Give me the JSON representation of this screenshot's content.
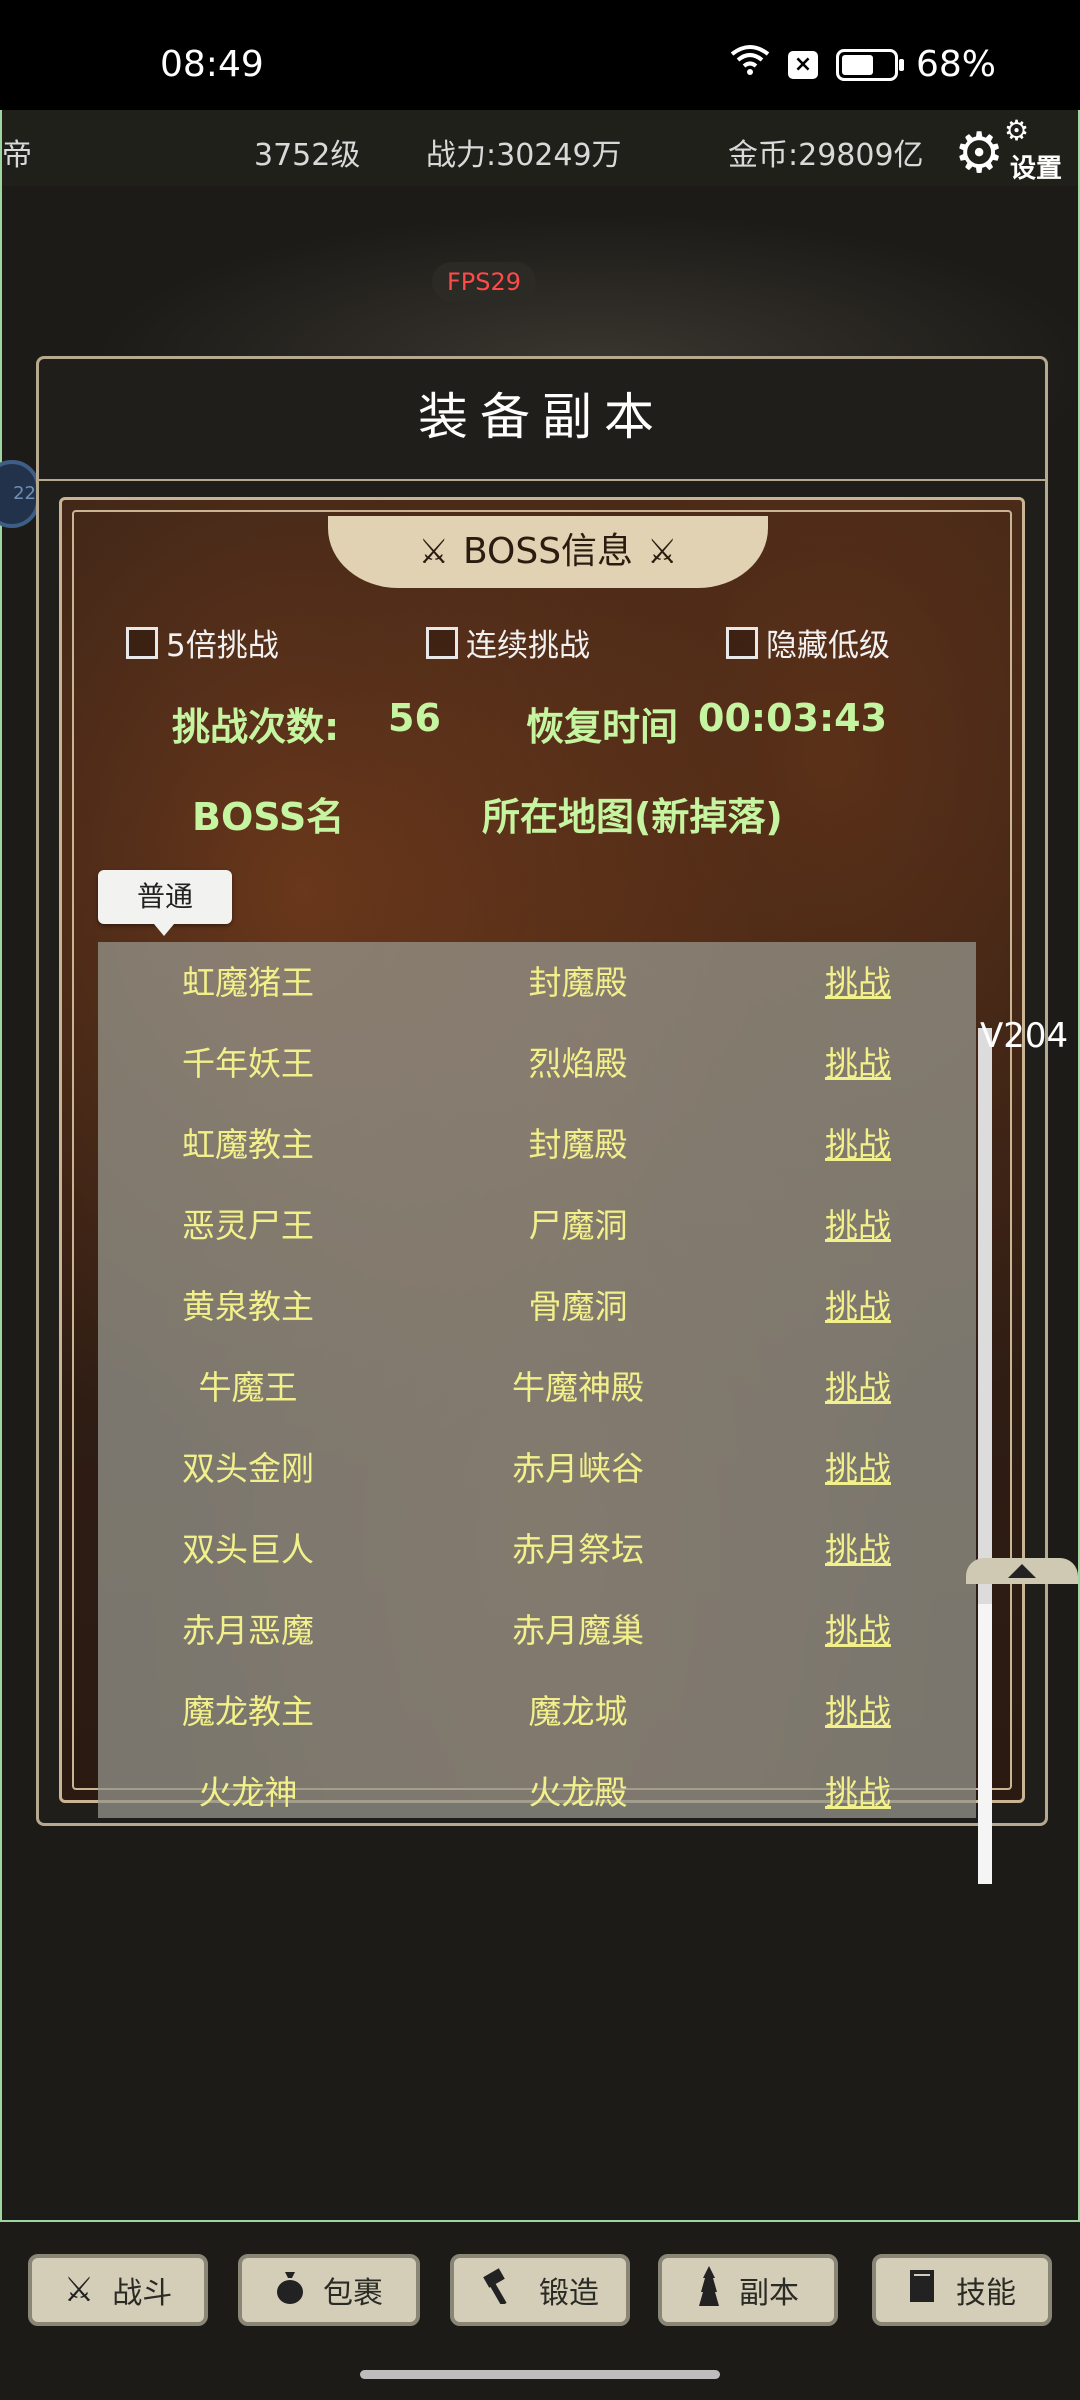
{
  "status_bar": {
    "time": "08:49",
    "battery_percent": "68%",
    "battery_level": 0.68
  },
  "top_bar": {
    "left_text": "帝",
    "level": "3752级",
    "power": "战力:30249万",
    "gold": "金币:29809亿",
    "settings_label": "设置"
  },
  "fps": "FPS29",
  "side_bubble": "22",
  "panel": {
    "title": "装备副本",
    "ribbon_title": "BOSS信息",
    "checkboxes": [
      "5倍挑战",
      "连续挑战",
      "隐藏低级"
    ],
    "challenge_count_label": "挑战次数:",
    "challenge_count": "56",
    "recover_label": "恢复时间",
    "recover_time": "00:03:43",
    "col_boss": "BOSS名",
    "col_map": "所在地图(新掉落)",
    "difficulty_tip": "普通",
    "version": "V204",
    "bosses": [
      {
        "name": "虹魔猪王",
        "map": "封魔殿",
        "action": "挑战"
      },
      {
        "name": "千年妖王",
        "map": "烈焰殿",
        "action": "挑战"
      },
      {
        "name": "虹魔教主",
        "map": "封魔殿",
        "action": "挑战"
      },
      {
        "name": "恶灵尸王",
        "map": "尸魔洞",
        "action": "挑战"
      },
      {
        "name": "黄泉教主",
        "map": "骨魔洞",
        "action": "挑战"
      },
      {
        "name": "牛魔王",
        "map": "牛魔神殿",
        "action": "挑战"
      },
      {
        "name": "双头金刚",
        "map": "赤月峡谷",
        "action": "挑战"
      },
      {
        "name": "双头巨人",
        "map": "赤月祭坛",
        "action": "挑战"
      },
      {
        "name": "赤月恶魔",
        "map": "赤月魔巢",
        "action": "挑战"
      },
      {
        "name": "魔龙教主",
        "map": "魔龙城",
        "action": "挑战"
      },
      {
        "name": "火龙神",
        "map": "火龙殿",
        "action": "挑战"
      }
    ]
  },
  "bottom_nav": [
    {
      "label": "战斗",
      "icon": "crossed-swords-icon"
    },
    {
      "label": "包裹",
      "icon": "bag-icon"
    },
    {
      "label": "锻造",
      "icon": "hammer-icon"
    },
    {
      "label": "副本",
      "icon": "tower-icon"
    },
    {
      "label": "技能",
      "icon": "book-icon"
    }
  ]
}
